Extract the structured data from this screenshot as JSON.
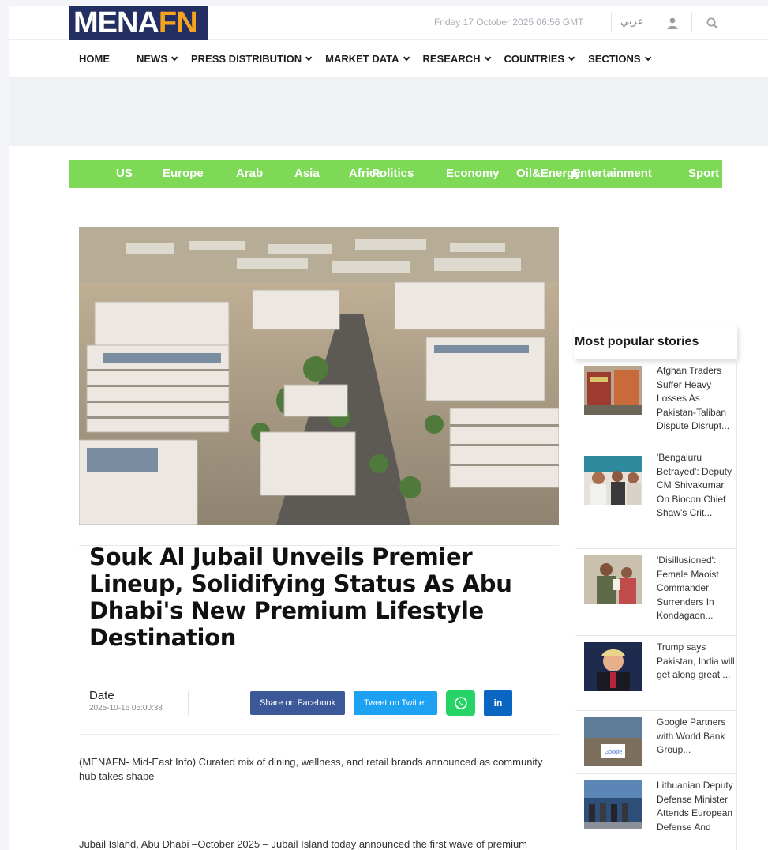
{
  "header": {
    "logo_part1": "MENA",
    "logo_part2": "FN",
    "date": "Friday 17 October 2025 06:56 GMT",
    "language": "عربي"
  },
  "nav": {
    "items": [
      {
        "label": "HOME",
        "has_dropdown": false
      },
      {
        "label": "NEWS",
        "has_dropdown": true
      },
      {
        "label": "PRESS DISTRIBUTION",
        "has_dropdown": true
      },
      {
        "label": "MARKET DATA",
        "has_dropdown": true
      },
      {
        "label": "RESEARCH",
        "has_dropdown": true
      },
      {
        "label": "COUNTRIES",
        "has_dropdown": true
      },
      {
        "label": "SECTIONS",
        "has_dropdown": true
      }
    ]
  },
  "categories": {
    "items": [
      "US",
      "Europe",
      "Arab",
      "Asia",
      "Africa",
      "Politics",
      "Economy",
      "Oil&Energy",
      "Entertainment",
      "Sport"
    ],
    "bar_color": "#7ed957"
  },
  "article": {
    "title": "Souk Al Jubail Unveils Premier Lineup, Solidifying Status As Abu Dhabi's New Premium Lifestyle Destination",
    "date_label": "Date",
    "date_value": "2025-10-16 05:00:38",
    "share_facebook": "Share on Facebook",
    "share_twitter": "Tweet on Twitter",
    "share_linkedin": "in",
    "paragraph1": "(MENAFN- Mid-East Info) Curated mix of dining, wellness, and retail brands announced as community hub takes shape",
    "paragraph2": "Jubail Island, Abu Dhabi –October 2025 – Jubail Island today announced the first wave of premium"
  },
  "sidebar": {
    "heading": "Most popular stories",
    "stories": [
      {
        "title": "Afghan Traders Suffer Heavy Losses As Pakistan-Taliban Dispute Disrupt..."
      },
      {
        "title": "'Bengaluru Betrayed': Deputy CM Shivakumar On Biocon Chief Shaw's Crit..."
      },
      {
        "title": "'Disillusioned': Female Maoist Commander Surrenders In Kondagaon..."
      },
      {
        "title": "Trump says Pakistan, India will get along great ..."
      },
      {
        "title": "Google Partners with World Bank Group..."
      },
      {
        "title": "Lithuanian Deputy Defense Minister Attends European Defense And"
      }
    ],
    "google_sign": "Google"
  },
  "colors": {
    "logo_bg": "#232f63",
    "logo_accent": "#f5a31f",
    "facebook": "#3b5998",
    "twitter": "#1da1f2",
    "whatsapp": "#25d366",
    "linkedin": "#0a66c2"
  }
}
